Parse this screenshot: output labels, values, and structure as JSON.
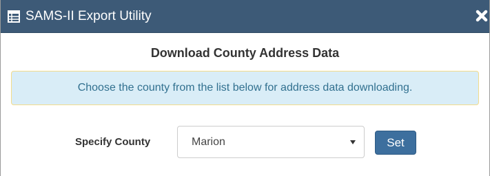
{
  "dialog": {
    "title": "SAMS-II Export Utility",
    "title_icon": "table-icon",
    "close_icon": "close-icon"
  },
  "main": {
    "heading": "Download County Address Data",
    "info_message": "Choose the county from the list below for address data downloading.",
    "county_label": "Specify County",
    "county_select": {
      "selected": "Marion"
    },
    "set_button": "Set"
  },
  "colors": {
    "titlebar": "#3d5a77",
    "alert_bg": "#d9edf7",
    "alert_border": "#f3dc8a",
    "alert_text": "#31708f",
    "button": "#3d6f9e"
  }
}
